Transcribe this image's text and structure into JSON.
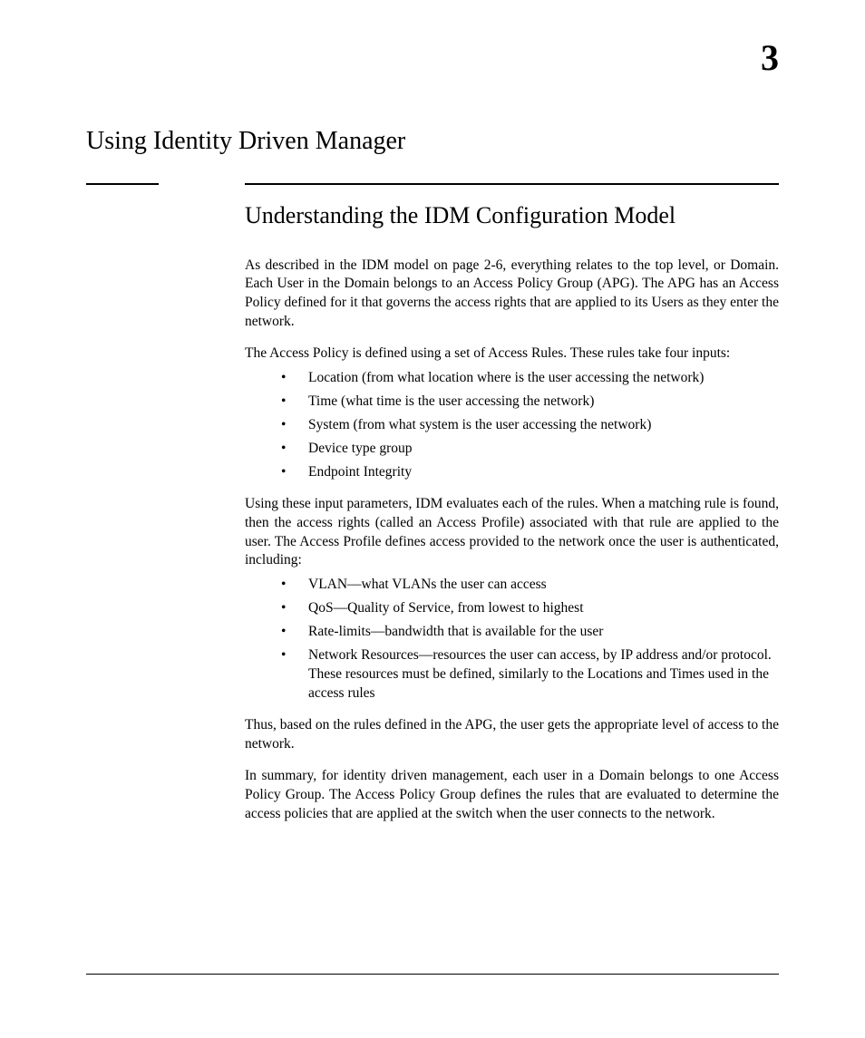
{
  "chapter_number": "3",
  "chapter_title": "Using Identity Driven Manager",
  "section_title": "Understanding the IDM Configuration Model",
  "para1": "As described in the IDM model on page 2-6, everything relates to the top level, or Domain. Each User in the Domain belongs to an Access Policy Group (APG). The APG has an Access Policy defined for it that governs the access rights that are applied to its Users as they enter the network.",
  "para2": "The Access Policy is defined using a set of Access Rules. These rules take four inputs:",
  "list1": [
    "Location (from what location where is the user accessing the network)",
    "Time (what time is the user accessing the network)",
    "System (from what system is the user accessing the network)",
    "Device type group",
    "Endpoint Integrity"
  ],
  "para3": "Using these input parameters, IDM evaluates each of the rules. When a matching rule is found, then the access rights (called an Access Profile) associated with that rule are applied to the user. The Access Profile defines access provided to the network once the user is authenticated, including:",
  "list2": [
    "VLAN—what VLANs the user can access",
    "QoS—Quality of Service, from lowest to highest",
    "Rate-limits—bandwidth that is available for the user",
    "Network Resources—resources the user can access, by IP address and/or protocol. These resources must be defined, similarly to the Locations and Times used in the access rules"
  ],
  "para4": "Thus, based on the rules defined in the APG, the user gets the appropriate level of access to the network.",
  "para5": "In summary, for identity driven management, each user in a Domain belongs to one Access Policy Group. The Access Policy Group defines the rules that are evaluated to determine the access policies that are applied at the switch when the user connects to the network."
}
